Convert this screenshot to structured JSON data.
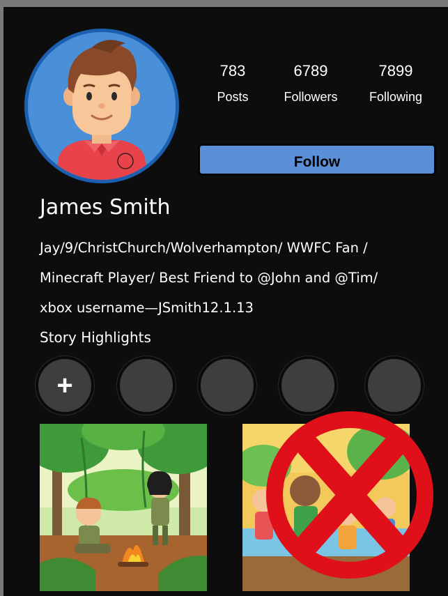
{
  "profile": {
    "name": "James Smith",
    "bio_lines": [
      "Jay/9/ChristChurch/Wolverhampton/ WWFC Fan /",
      "Minecraft Player/ Best Friend to @John and @Tim/",
      "xbox username—JSmith12.1.13"
    ],
    "avatar_icon": "boy-avatar-icon"
  },
  "stats": [
    {
      "value": "783",
      "label": "Posts"
    },
    {
      "value": "6789",
      "label": "Followers"
    },
    {
      "value": "7899",
      "label": "Following"
    }
  ],
  "follow_label": "Follow",
  "highlights": {
    "title": "Story Highlights",
    "add_symbol": "+",
    "count": 5
  },
  "posts": [
    {
      "icon": "camping-children-image",
      "crossed_out": false
    },
    {
      "icon": "children-playing-image",
      "crossed_out": true,
      "overlay_icon": "red-cross-icon"
    }
  ],
  "colors": {
    "background": "#0d0d0d",
    "follow_button": "#5b8fd8",
    "avatar_bg": "#4a90d9",
    "highlight": "#3e3e3e",
    "cross": "#e0101a"
  }
}
